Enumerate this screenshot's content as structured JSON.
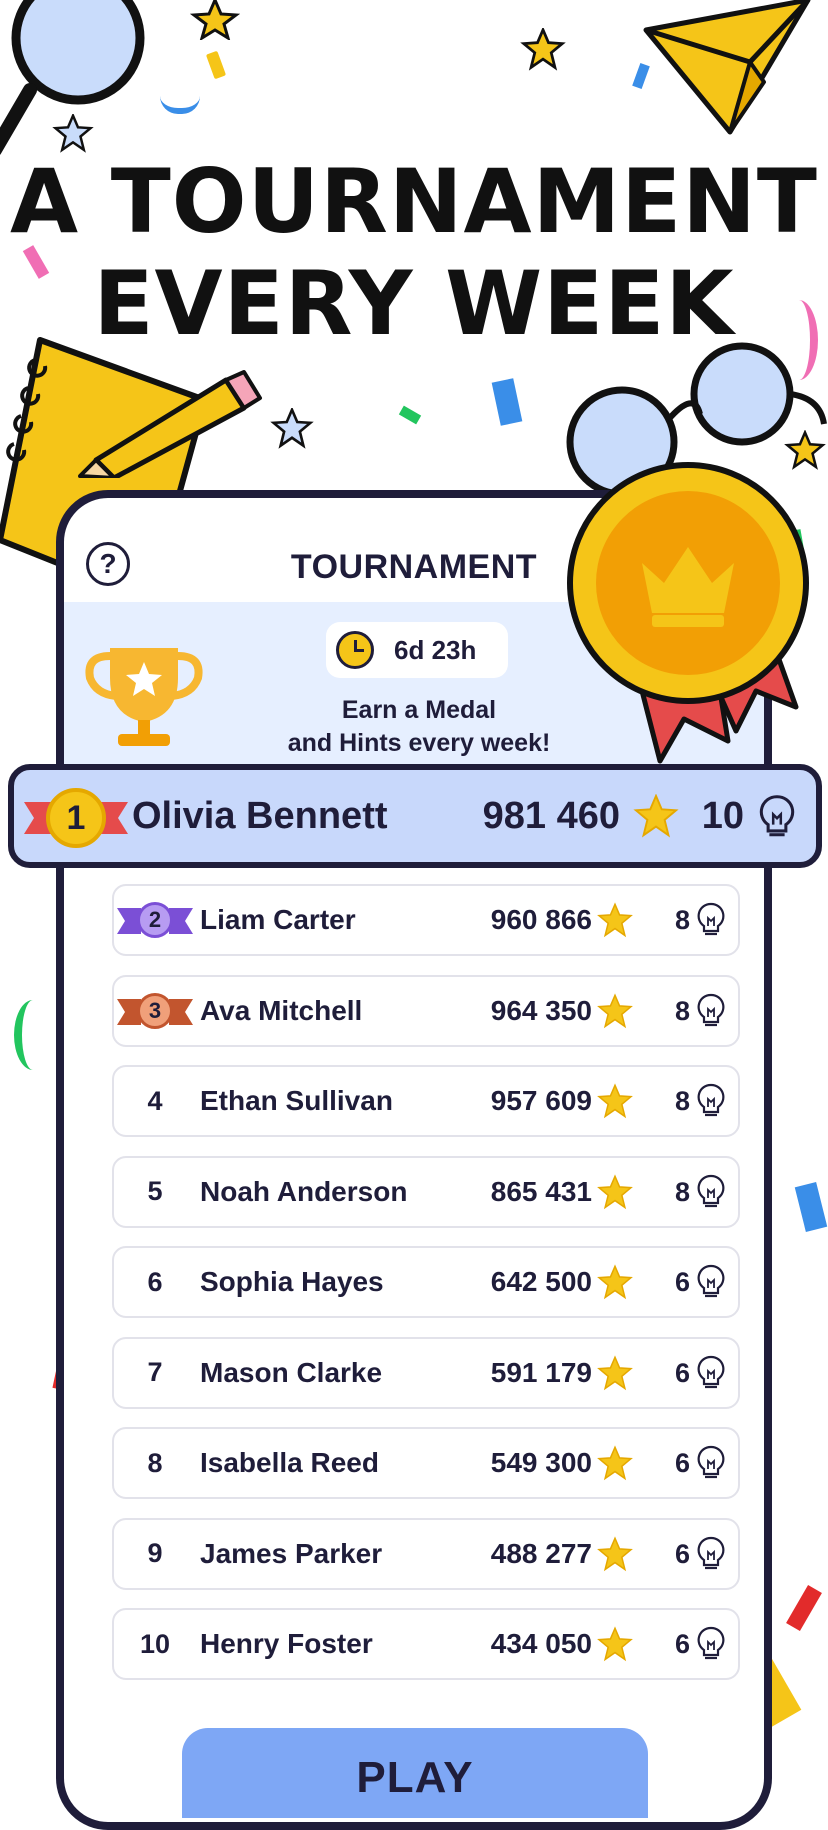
{
  "headline": {
    "line1": "A TOURNAMENT",
    "line2": "EVERY WEEK"
  },
  "screen": {
    "title": "TOURNAMENT",
    "help_icon": "?",
    "timer": "6d 23h",
    "banner_line1": "Earn a Medal",
    "banner_line2": "and Hints every week!"
  },
  "highlight_player": {
    "rank": "1",
    "name": "Olivia Bennett",
    "score": "981 460",
    "hints": "10"
  },
  "leaderboard": [
    {
      "rank": "2",
      "name": "Liam Carter",
      "score": "960 866",
      "hints": "8",
      "medal": "silver"
    },
    {
      "rank": "3",
      "name": "Ava Mitchell",
      "score": "964 350",
      "hints": "8",
      "medal": "bronze"
    },
    {
      "rank": "4",
      "name": "Ethan Sullivan",
      "score": "957 609",
      "hints": "8"
    },
    {
      "rank": "5",
      "name": "Noah Anderson",
      "score": "865 431",
      "hints": "8"
    },
    {
      "rank": "6",
      "name": "Sophia Hayes",
      "score": "642 500",
      "hints": "6"
    },
    {
      "rank": "7",
      "name": "Mason Clarke",
      "score": "591 179",
      "hints": "6"
    },
    {
      "rank": "8",
      "name": "Isabella Reed",
      "score": "549 300",
      "hints": "6"
    },
    {
      "rank": "9",
      "name": "James Parker",
      "score": "488 277",
      "hints": "6"
    },
    {
      "rank": "10",
      "name": "Henry Foster",
      "score": "434 050",
      "hints": "6"
    }
  ],
  "play_button": "PLAY",
  "colors": {
    "navy": "#1f1d3a",
    "banner": "#e6efff",
    "highlight": "#c8d8fb",
    "play": "#7ea7f5",
    "gold": "#f5c518",
    "silver_medal": "#b79cf2",
    "bronze_medal": "#f0a07a"
  },
  "icons": [
    "question-icon",
    "clock-icon",
    "trophy-icon",
    "gold-medal-icon",
    "star-icon",
    "lightbulb-icon",
    "magnifier-icon",
    "paper-plane-icon",
    "notebook-icon",
    "pencil-icon",
    "glasses-icon"
  ]
}
